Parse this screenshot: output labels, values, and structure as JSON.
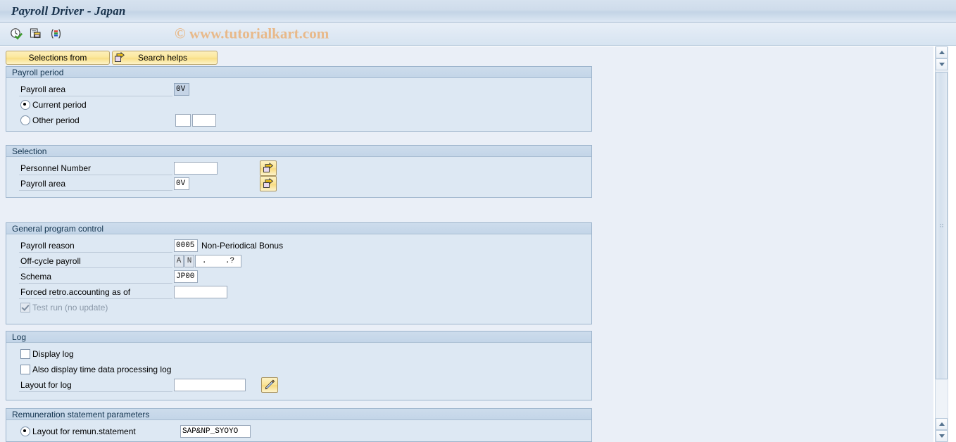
{
  "window": {
    "title": "Payroll Driver - Japan"
  },
  "toolbar": {
    "icons": [
      {
        "name": "execute-clock-icon",
        "title": "Execute"
      },
      {
        "name": "copy-document-icon",
        "title": "Get variant"
      },
      {
        "name": "variant-list-icon",
        "title": "Display variant"
      }
    ],
    "watermark": "© www.tutorialkart.com"
  },
  "buttons": {
    "selections_from": "Selections from",
    "search_helps": "Search helps"
  },
  "groups": {
    "payroll_period": {
      "title": "Payroll period",
      "payroll_area_label": "Payroll area",
      "payroll_area_value": "0V",
      "current_period_label": "Current period",
      "other_period_label": "Other period",
      "other_period_value_1": "",
      "other_period_value_2": "",
      "selected": "current"
    },
    "selection": {
      "title": "Selection",
      "personnel_number_label": "Personnel Number",
      "personnel_number_value": "",
      "payroll_area_label": "Payroll area",
      "payroll_area_value": "0V",
      "multi_select_title": "Multiple selection"
    },
    "general_program_control": {
      "title": "General program control",
      "payroll_reason_label": "Payroll reason",
      "payroll_reason_value": "0005",
      "payroll_reason_text": "Non-Periodical Bonus",
      "off_cycle_label": "Off-cycle payroll",
      "off_cycle_value_1": "A",
      "off_cycle_value_2": "N",
      "off_cycle_date": ".    .?",
      "schema_label": "Schema",
      "schema_value": "JP00",
      "forced_retro_label": "Forced retro.accounting as of",
      "forced_retro_value": "",
      "test_run_label": "Test run (no update)",
      "test_run_checked": true,
      "test_run_disabled": true
    },
    "log": {
      "title": "Log",
      "display_log_label": "Display log",
      "display_log_checked": false,
      "time_data_log_label": "Also display time data processing log",
      "time_data_log_checked": false,
      "layout_for_log_label": "Layout for log",
      "layout_for_log_value": "",
      "layout_button_title": "Choose layout"
    },
    "remuneration": {
      "title": "Remuneration statement parameters",
      "layout_label": "Layout for remun.statement",
      "layout_value": "SAP&NP_SYOYO",
      "selected": true
    }
  },
  "scrollbar": {
    "up_title": "Scroll up",
    "down_title": "Scroll down"
  },
  "colors": {
    "title_text": "#19334d",
    "group_header": "#c3d5e8",
    "button_yellow": "#fbe79b",
    "watermark": "#e8b98a",
    "content_bg": "#eaeff7"
  }
}
